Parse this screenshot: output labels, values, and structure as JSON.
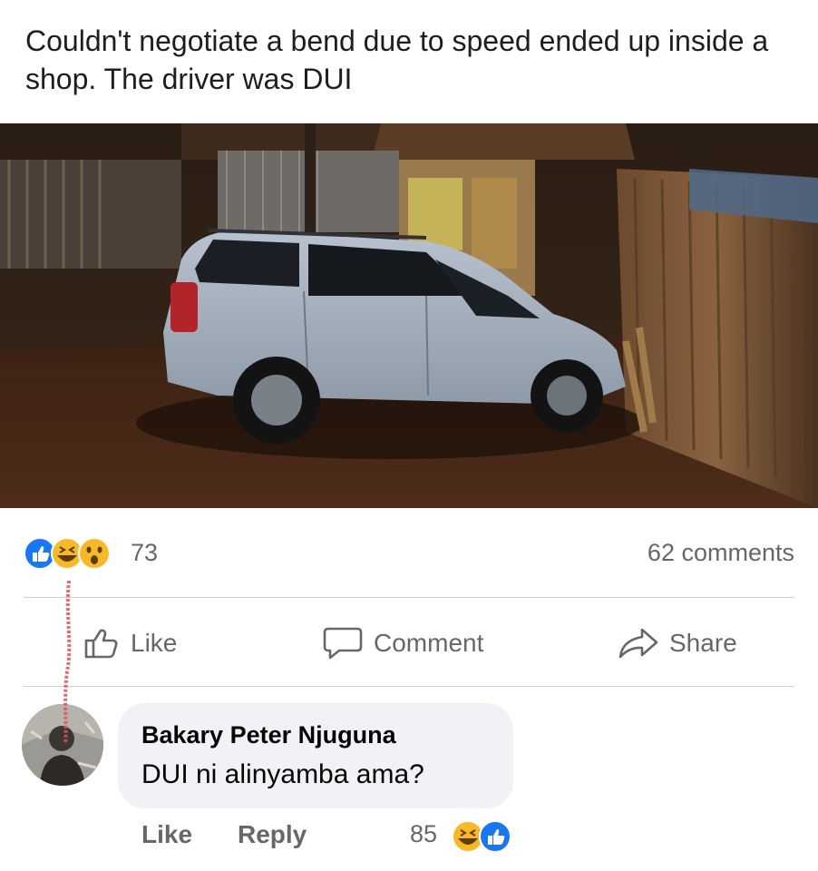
{
  "post": {
    "text": "Couldn't negotiate a bend due to speed ended up inside a shop. The driver was DUI"
  },
  "photo": {
    "description_icon": "car-crash-photo"
  },
  "reactions": {
    "icons": [
      "like-icon",
      "haha-icon",
      "wow-icon"
    ],
    "count": "73",
    "comments_count": "62 comments"
  },
  "actions": {
    "like_label": "Like",
    "comment_label": "Comment",
    "share_label": "Share"
  },
  "comment": {
    "author": "Bakary Peter Njuguna",
    "text": "DUI ni alinyamba ama?",
    "like_label": "Like",
    "reply_label": "Reply",
    "reaction_count": "85",
    "reaction_icons": [
      "haha-icon",
      "like-icon"
    ]
  },
  "colors": {
    "muted_text": "#65676b",
    "like_blue": "#1877f2",
    "haha_yellow": "#f7b928",
    "bubble_bg": "#f0f2f5",
    "divider": "#ced0d4"
  }
}
